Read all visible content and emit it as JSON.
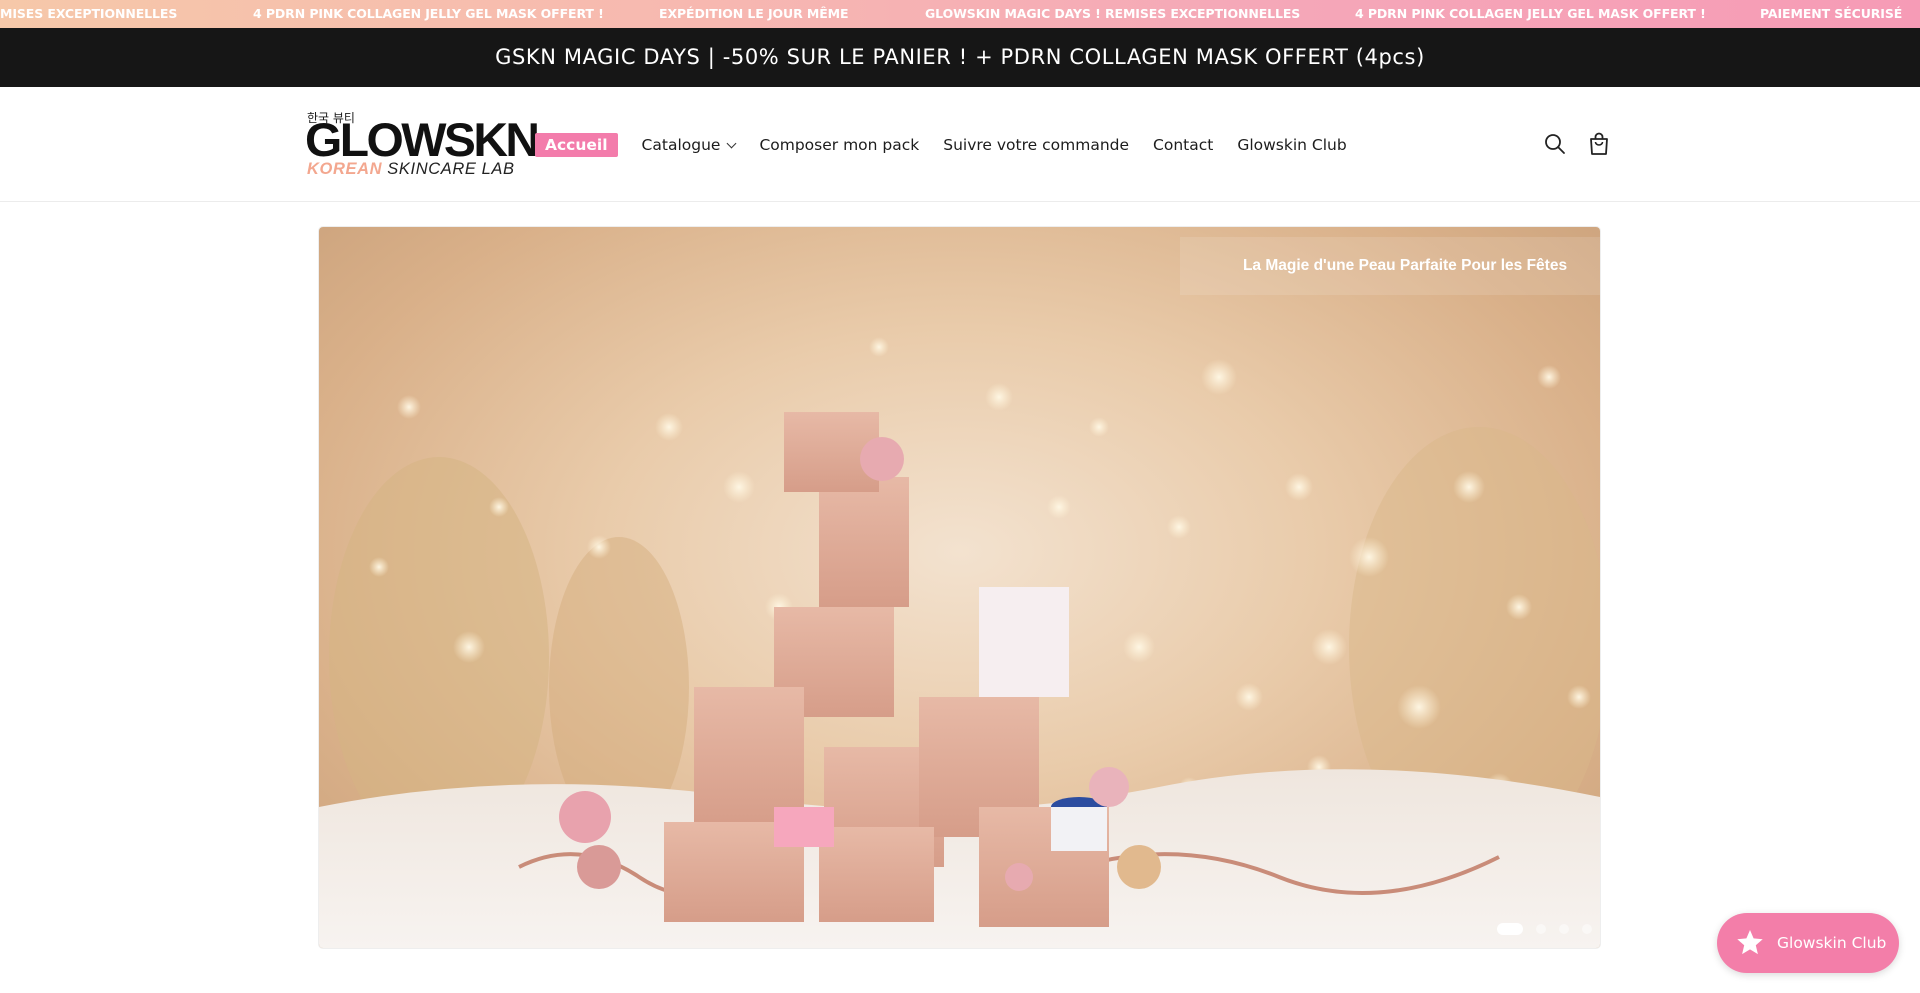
{
  "marquee": {
    "items": [
      "MISES EXCEPTIONNELLES",
      "4 PDRN PINK COLLAGEN JELLY GEL MASK OFFERT !",
      "EXPÉDITION LE JOUR MÊME",
      "GLOWSKIN MAGIC DAYS ! REMISES EXCEPTIONNELLES",
      "4 PDRN PINK COLLAGEN JELLY GEL MASK OFFERT !",
      "PAIEMENT SÉCURISÉ"
    ]
  },
  "announcement": "GSKN MAGIC DAYS | -50% SUR LE PANIER ! + PDRN COLLAGEN MASK OFFERT (4pcs)",
  "logo": {
    "korean": "한국 뷰티",
    "main": "GLOWSKN",
    "sub_accent": "KOREAN",
    "sub_rest": " SKINCARE LAB"
  },
  "nav": {
    "items": [
      {
        "label": "Accueil",
        "active": true
      },
      {
        "label": "Catalogue",
        "dropdown": true
      },
      {
        "label": "Composer mon pack"
      },
      {
        "label": "Suivre votre commande"
      },
      {
        "label": "Contact"
      },
      {
        "label": "Glowskin Club"
      }
    ]
  },
  "header_icons": [
    "search-icon",
    "shopping-bag-icon"
  ],
  "hero": {
    "caption": "La Magie d'une Peau Parfaite Pour les Fêtes",
    "slides_count": 4,
    "active_slide": 1
  },
  "club_button": {
    "label": "Glowskin Club",
    "icon": "star-icon",
    "color": "#f37ea9"
  },
  "colors": {
    "accent_pink": "#f37cab",
    "announcement_bg": "#161616"
  }
}
